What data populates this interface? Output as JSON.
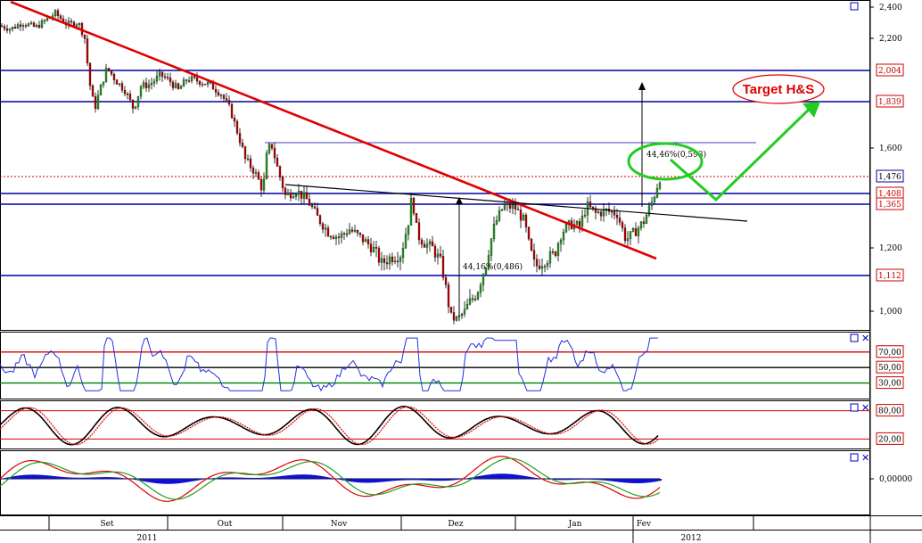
{
  "chart_data": [
    {
      "type": "candlestick",
      "panel": "price",
      "y_ticks": [
        "2,400",
        "2,200",
        "1,600",
        "1,200",
        "1,000"
      ],
      "ylim": [
        880,
        2450
      ],
      "horizontal_levels": [
        {
          "label": "2,004",
          "value": 2004,
          "color": "#0000a0"
        },
        {
          "label": "1,839",
          "value": 1839,
          "color": "#0000a0"
        },
        {
          "label": "1,476",
          "value": 1476,
          "color": "#d00000",
          "style": "dotted"
        },
        {
          "label": "1,408",
          "value": 1408,
          "color": "#0000a0"
        },
        {
          "label": "1,365",
          "value": 1365,
          "color": "#0000a0"
        },
        {
          "label": "1,112",
          "value": 1112,
          "color": "#0000a0"
        }
      ],
      "annotations": {
        "target_label": "Target H&S",
        "measure_left": "44,16%(0,486)",
        "measure_right": "44,46%(0,593)"
      },
      "price_path": [
        [
          0,
          2280
        ],
        [
          12,
          2260
        ],
        [
          25,
          2300
        ],
        [
          40,
          2270
        ],
        [
          55,
          2330
        ],
        [
          62,
          2360
        ],
        [
          75,
          2290
        ],
        [
          88,
          2300
        ],
        [
          95,
          2200
        ],
        [
          100,
          1950
        ],
        [
          106,
          1800
        ],
        [
          112,
          1900
        ],
        [
          120,
          2020
        ],
        [
          130,
          1950
        ],
        [
          140,
          1900
        ],
        [
          150,
          1800
        ],
        [
          158,
          1920
        ],
        [
          168,
          1930
        ],
        [
          180,
          1980
        ],
        [
          190,
          1950
        ],
        [
          200,
          1900
        ],
        [
          210,
          1960
        ],
        [
          222,
          1950
        ],
        [
          235,
          1930
        ],
        [
          248,
          1880
        ],
        [
          258,
          1800
        ],
        [
          265,
          1700
        ],
        [
          275,
          1550
        ],
        [
          285,
          1500
        ],
        [
          295,
          1420
        ],
        [
          300,
          1600
        ],
        [
          305,
          1610
        ],
        [
          312,
          1500
        ],
        [
          320,
          1400
        ],
        [
          332,
          1420
        ],
        [
          345,
          1380
        ],
        [
          355,
          1320
        ],
        [
          368,
          1260
        ],
        [
          380,
          1240
        ],
        [
          392,
          1270
        ],
        [
          404,
          1240
        ],
        [
          418,
          1200
        ],
        [
          428,
          1150
        ],
        [
          438,
          1170
        ],
        [
          450,
          1180
        ],
        [
          458,
          1300
        ],
        [
          462,
          1400
        ],
        [
          468,
          1250
        ],
        [
          475,
          1220
        ],
        [
          485,
          1200
        ],
        [
          495,
          1150
        ],
        [
          502,
          1040
        ],
        [
          508,
          940
        ],
        [
          515,
          960
        ],
        [
          525,
          1020
        ],
        [
          535,
          1060
        ],
        [
          545,
          1150
        ],
        [
          555,
          1290
        ],
        [
          565,
          1360
        ],
        [
          578,
          1350
        ],
        [
          588,
          1300
        ],
        [
          594,
          1200
        ],
        [
          600,
          1140
        ],
        [
          610,
          1160
        ],
        [
          622,
          1180
        ],
        [
          630,
          1260
        ],
        [
          640,
          1290
        ],
        [
          650,
          1280
        ],
        [
          658,
          1360
        ],
        [
          668,
          1330
        ],
        [
          680,
          1340
        ],
        [
          692,
          1330
        ],
        [
          702,
          1230
        ],
        [
          712,
          1260
        ],
        [
          722,
          1300
        ],
        [
          732,
          1380
        ],
        [
          738,
          1450
        ],
        [
          742,
          1490
        ]
      ]
    },
    {
      "type": "line",
      "panel": "rsi",
      "y_ticks": [
        "70,00",
        "50,00",
        "30,00"
      ],
      "levels": [
        70,
        50,
        30
      ],
      "ylim": [
        10,
        95
      ]
    },
    {
      "type": "line",
      "panel": "stochastic",
      "y_ticks": [
        "80,00",
        "20,00"
      ],
      "levels": [
        80,
        20
      ],
      "ylim": [
        0,
        100
      ]
    },
    {
      "type": "histogram",
      "panel": "macd",
      "y_ticks": [
        "0,00000"
      ],
      "ylim": [
        -1,
        1
      ]
    }
  ],
  "x_axis": {
    "months": [
      "Set",
      "Out",
      "Nov",
      "Dez",
      "Jan",
      "Fev"
    ],
    "years": [
      "2011",
      "2012"
    ]
  }
}
